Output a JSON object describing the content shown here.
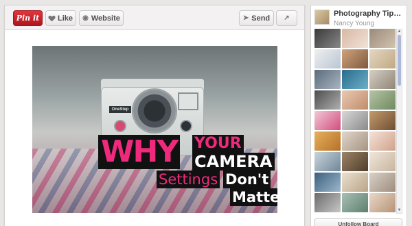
{
  "toolbar": {
    "pin_it_label": "Pin it",
    "like_label": "Like",
    "website_label": "Website",
    "send_label": "Send"
  },
  "pin_image": {
    "camera_brand": "OneStep",
    "headline_why": "WHY",
    "headline_your": "YOUR",
    "headline_camera": "CAMERA",
    "headline_settings": "Settings",
    "headline_dont": "Don't",
    "headline_matter": "Matter?"
  },
  "board": {
    "title": "Photography Tips & T...",
    "owner": "Nancy Young",
    "unfollow_label": "Unfollow Board"
  },
  "colors": {
    "pin_red": "#c8232c",
    "headline_pink": "#ef2a7c"
  }
}
